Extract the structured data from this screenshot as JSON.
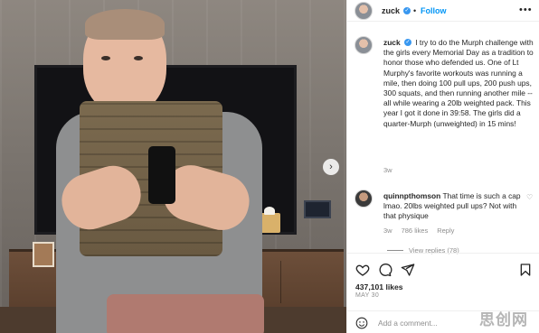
{
  "post": {
    "author": "zuck",
    "follow_label": "Follow",
    "separator": "•",
    "more_label": "•••",
    "caption": "I try to do the Murph challenge with the girls every Memorial Day as a tradition to honor those who defended us. One of Lt Murphy's favorite workouts was running a mile, then doing 100 pull ups, 200 push ups, 300 squats, and then running another mile -- all while wearing a 20lb weighted pack. This year I got it done in 39:58. The girls did a quarter-Murph (unweighted) in 15 mins!",
    "caption_time": "3w",
    "likes": "437,101 likes",
    "date": "MAY 30"
  },
  "comment": {
    "user": "quinnpthomson",
    "text": "That time is such a cap lmao. 20lbs weighted pull ups? Not with that physique",
    "time": "3w",
    "likes": "786 likes",
    "reply_label": "Reply",
    "view_replies": "View replies (78)"
  },
  "add_comment": {
    "placeholder": "Add a comment..."
  },
  "watermark": "思创网",
  "icons": {
    "next": "chevron-right-icon",
    "like": "heart-icon",
    "comment": "comment-bubble-icon",
    "share": "paper-plane-icon",
    "save": "bookmark-icon",
    "emoji": "emoji-icon"
  },
  "colors": {
    "accent": "#0095f6",
    "verified": "#3897f0",
    "muted": "#8e8e8e",
    "text": "#262626"
  }
}
